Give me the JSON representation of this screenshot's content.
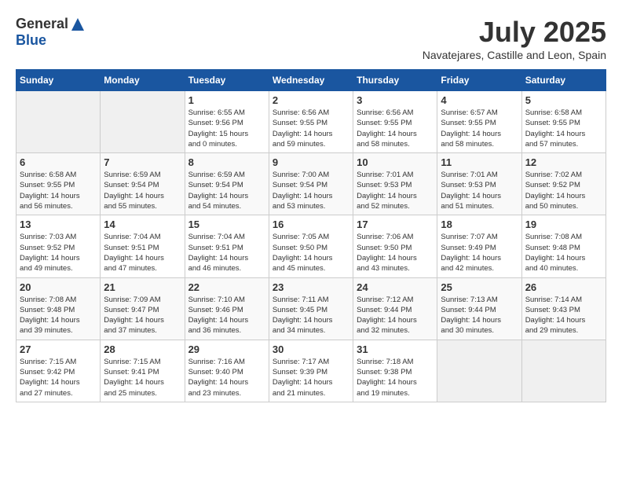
{
  "logo": {
    "general": "General",
    "blue": "Blue"
  },
  "title": "July 2025",
  "subtitle": "Navatejares, Castille and Leon, Spain",
  "days_header": [
    "Sunday",
    "Monday",
    "Tuesday",
    "Wednesday",
    "Thursday",
    "Friday",
    "Saturday"
  ],
  "weeks": [
    [
      {
        "day": "",
        "info": ""
      },
      {
        "day": "",
        "info": ""
      },
      {
        "day": "1",
        "info": "Sunrise: 6:55 AM\nSunset: 9:56 PM\nDaylight: 15 hours\nand 0 minutes."
      },
      {
        "day": "2",
        "info": "Sunrise: 6:56 AM\nSunset: 9:55 PM\nDaylight: 14 hours\nand 59 minutes."
      },
      {
        "day": "3",
        "info": "Sunrise: 6:56 AM\nSunset: 9:55 PM\nDaylight: 14 hours\nand 58 minutes."
      },
      {
        "day": "4",
        "info": "Sunrise: 6:57 AM\nSunset: 9:55 PM\nDaylight: 14 hours\nand 58 minutes."
      },
      {
        "day": "5",
        "info": "Sunrise: 6:58 AM\nSunset: 9:55 PM\nDaylight: 14 hours\nand 57 minutes."
      }
    ],
    [
      {
        "day": "6",
        "info": "Sunrise: 6:58 AM\nSunset: 9:55 PM\nDaylight: 14 hours\nand 56 minutes."
      },
      {
        "day": "7",
        "info": "Sunrise: 6:59 AM\nSunset: 9:54 PM\nDaylight: 14 hours\nand 55 minutes."
      },
      {
        "day": "8",
        "info": "Sunrise: 6:59 AM\nSunset: 9:54 PM\nDaylight: 14 hours\nand 54 minutes."
      },
      {
        "day": "9",
        "info": "Sunrise: 7:00 AM\nSunset: 9:54 PM\nDaylight: 14 hours\nand 53 minutes."
      },
      {
        "day": "10",
        "info": "Sunrise: 7:01 AM\nSunset: 9:53 PM\nDaylight: 14 hours\nand 52 minutes."
      },
      {
        "day": "11",
        "info": "Sunrise: 7:01 AM\nSunset: 9:53 PM\nDaylight: 14 hours\nand 51 minutes."
      },
      {
        "day": "12",
        "info": "Sunrise: 7:02 AM\nSunset: 9:52 PM\nDaylight: 14 hours\nand 50 minutes."
      }
    ],
    [
      {
        "day": "13",
        "info": "Sunrise: 7:03 AM\nSunset: 9:52 PM\nDaylight: 14 hours\nand 49 minutes."
      },
      {
        "day": "14",
        "info": "Sunrise: 7:04 AM\nSunset: 9:51 PM\nDaylight: 14 hours\nand 47 minutes."
      },
      {
        "day": "15",
        "info": "Sunrise: 7:04 AM\nSunset: 9:51 PM\nDaylight: 14 hours\nand 46 minutes."
      },
      {
        "day": "16",
        "info": "Sunrise: 7:05 AM\nSunset: 9:50 PM\nDaylight: 14 hours\nand 45 minutes."
      },
      {
        "day": "17",
        "info": "Sunrise: 7:06 AM\nSunset: 9:50 PM\nDaylight: 14 hours\nand 43 minutes."
      },
      {
        "day": "18",
        "info": "Sunrise: 7:07 AM\nSunset: 9:49 PM\nDaylight: 14 hours\nand 42 minutes."
      },
      {
        "day": "19",
        "info": "Sunrise: 7:08 AM\nSunset: 9:48 PM\nDaylight: 14 hours\nand 40 minutes."
      }
    ],
    [
      {
        "day": "20",
        "info": "Sunrise: 7:08 AM\nSunset: 9:48 PM\nDaylight: 14 hours\nand 39 minutes."
      },
      {
        "day": "21",
        "info": "Sunrise: 7:09 AM\nSunset: 9:47 PM\nDaylight: 14 hours\nand 37 minutes."
      },
      {
        "day": "22",
        "info": "Sunrise: 7:10 AM\nSunset: 9:46 PM\nDaylight: 14 hours\nand 36 minutes."
      },
      {
        "day": "23",
        "info": "Sunrise: 7:11 AM\nSunset: 9:45 PM\nDaylight: 14 hours\nand 34 minutes."
      },
      {
        "day": "24",
        "info": "Sunrise: 7:12 AM\nSunset: 9:44 PM\nDaylight: 14 hours\nand 32 minutes."
      },
      {
        "day": "25",
        "info": "Sunrise: 7:13 AM\nSunset: 9:44 PM\nDaylight: 14 hours\nand 30 minutes."
      },
      {
        "day": "26",
        "info": "Sunrise: 7:14 AM\nSunset: 9:43 PM\nDaylight: 14 hours\nand 29 minutes."
      }
    ],
    [
      {
        "day": "27",
        "info": "Sunrise: 7:15 AM\nSunset: 9:42 PM\nDaylight: 14 hours\nand 27 minutes."
      },
      {
        "day": "28",
        "info": "Sunrise: 7:15 AM\nSunset: 9:41 PM\nDaylight: 14 hours\nand 25 minutes."
      },
      {
        "day": "29",
        "info": "Sunrise: 7:16 AM\nSunset: 9:40 PM\nDaylight: 14 hours\nand 23 minutes."
      },
      {
        "day": "30",
        "info": "Sunrise: 7:17 AM\nSunset: 9:39 PM\nDaylight: 14 hours\nand 21 minutes."
      },
      {
        "day": "31",
        "info": "Sunrise: 7:18 AM\nSunset: 9:38 PM\nDaylight: 14 hours\nand 19 minutes."
      },
      {
        "day": "",
        "info": ""
      },
      {
        "day": "",
        "info": ""
      }
    ]
  ]
}
